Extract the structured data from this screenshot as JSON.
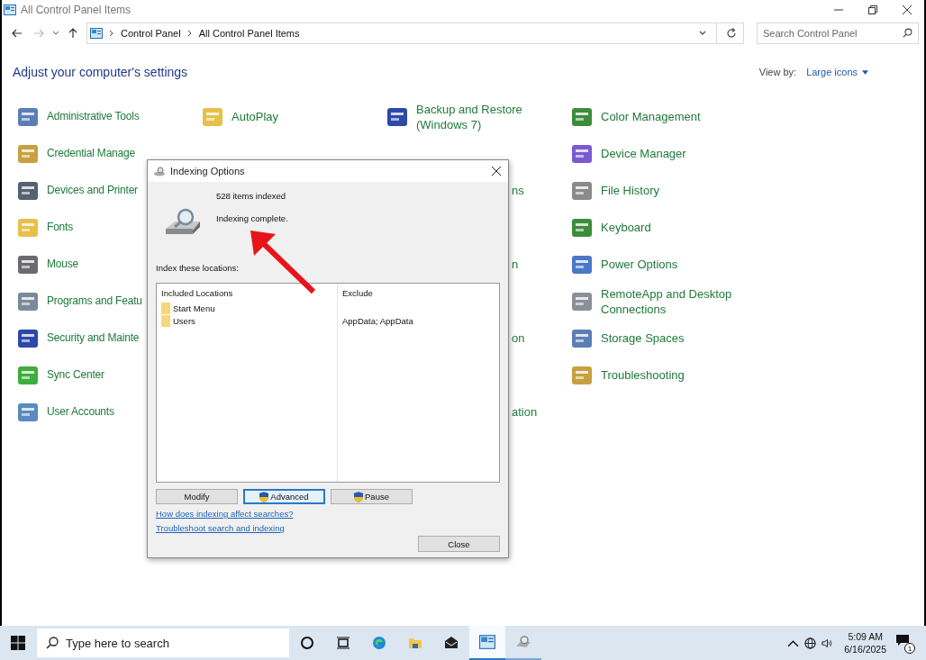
{
  "window": {
    "title": "All Control Panel Items"
  },
  "address": {
    "crumbs": [
      "Control Panel",
      "All Control Panel Items"
    ],
    "search_placeholder": "Search Control Panel",
    "forward_disabled": true
  },
  "heading": "Adjust your computer's settings",
  "view_by": {
    "label": "View by:",
    "value": "Large icons"
  },
  "columns": [
    [
      {
        "label": "Administrative Tools"
      },
      {
        "label": "Credential Manage"
      },
      {
        "label": "Devices and Printer"
      },
      {
        "label": "Fonts"
      },
      {
        "label": "Mouse"
      },
      {
        "label": "Programs and Featu"
      },
      {
        "label": "Security and Mainte"
      },
      {
        "label": "Sync Center"
      },
      {
        "label": "User Accounts"
      }
    ],
    [
      {
        "label": "AutoPlay"
      }
    ],
    [
      {
        "label": "Backup and Restore (Windows 7)",
        "partial": false
      },
      {
        "label": "ns",
        "partial": true
      },
      {
        "label": "n",
        "partial": true
      },
      {
        "label": "on",
        "partial": true
      },
      {
        "label": "ation",
        "partial": true
      }
    ],
    [
      {
        "label": "Color Management"
      },
      {
        "label": "Device Manager"
      },
      {
        "label": "File History"
      },
      {
        "label": "Keyboard"
      },
      {
        "label": "Power Options"
      },
      {
        "label": "RemoteApp and Desktop Connections"
      },
      {
        "label": "Storage Spaces"
      },
      {
        "label": "Troubleshooting"
      }
    ]
  ],
  "dialog": {
    "title": "Indexing Options",
    "count": "528 items indexed",
    "status": "Indexing complete.",
    "list_label": "Index these locations:",
    "headers": [
      "Included Locations",
      "Exclude"
    ],
    "locations": [
      {
        "name": "Start Menu"
      },
      {
        "name": "Users",
        "exclude": "AppData; AppData"
      }
    ],
    "buttons": [
      {
        "label": "Modify",
        "shield": false,
        "focused": false
      },
      {
        "label": "Advanced",
        "shield": true,
        "focused": true
      },
      {
        "label": "Pause",
        "shield": true,
        "focused": false
      }
    ],
    "links": [
      "How does indexing affect searches?",
      "Troubleshoot search and indexing"
    ],
    "close": "Close"
  },
  "taskbar": {
    "search_placeholder": "Type here to search",
    "apps": [
      {
        "selected": true
      },
      {
        "selected": false
      }
    ],
    "time": "5:09 AM",
    "date": "6/16/2025",
    "notifications": "1"
  }
}
